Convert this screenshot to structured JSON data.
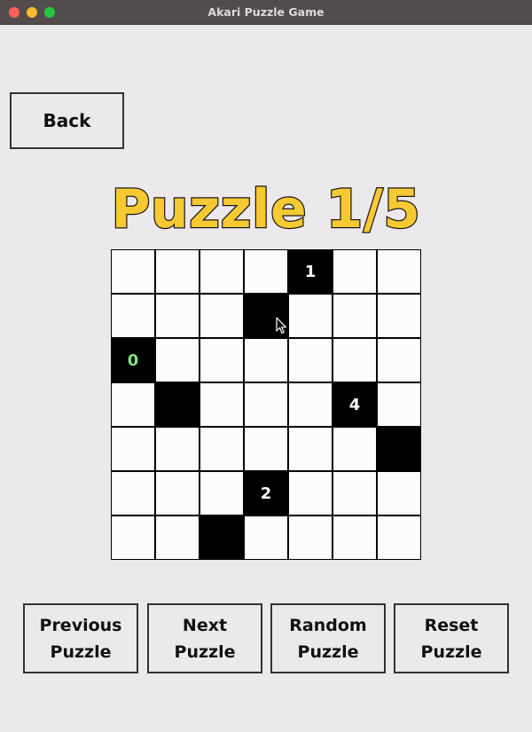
{
  "window": {
    "title": "Akari Puzzle Game"
  },
  "back_button": {
    "label": "Back"
  },
  "puzzle": {
    "title": "Puzzle 1/5",
    "size": 7,
    "cells": [
      [
        "",
        "",
        "",
        "",
        "1",
        "",
        ""
      ],
      [
        "",
        "",
        "",
        "#",
        "",
        "",
        ""
      ],
      [
        "0",
        "",
        "",
        "",
        "",
        "",
        ""
      ],
      [
        "",
        "#",
        "",
        "",
        "",
        "4",
        ""
      ],
      [
        "",
        "",
        "",
        "",
        "",
        "",
        "#"
      ],
      [
        "",
        "",
        "",
        "2",
        "",
        "",
        ""
      ],
      [
        "",
        "",
        "#",
        "",
        "",
        "",
        ""
      ]
    ],
    "satisfied_clues": [
      [
        2,
        0
      ]
    ]
  },
  "controls": {
    "previous": {
      "line1": "Previous",
      "line2": "Puzzle"
    },
    "next": {
      "line1": "Next",
      "line2": "Puzzle"
    },
    "random": {
      "line1": "Random",
      "line2": "Puzzle"
    },
    "reset": {
      "line1": "Reset",
      "line2": "Puzzle"
    }
  },
  "colors": {
    "title_fill": "#f6c933",
    "satisfied_clue": "#7be47b",
    "wall": "#000000",
    "empty_cell": "#fcfbfd"
  }
}
